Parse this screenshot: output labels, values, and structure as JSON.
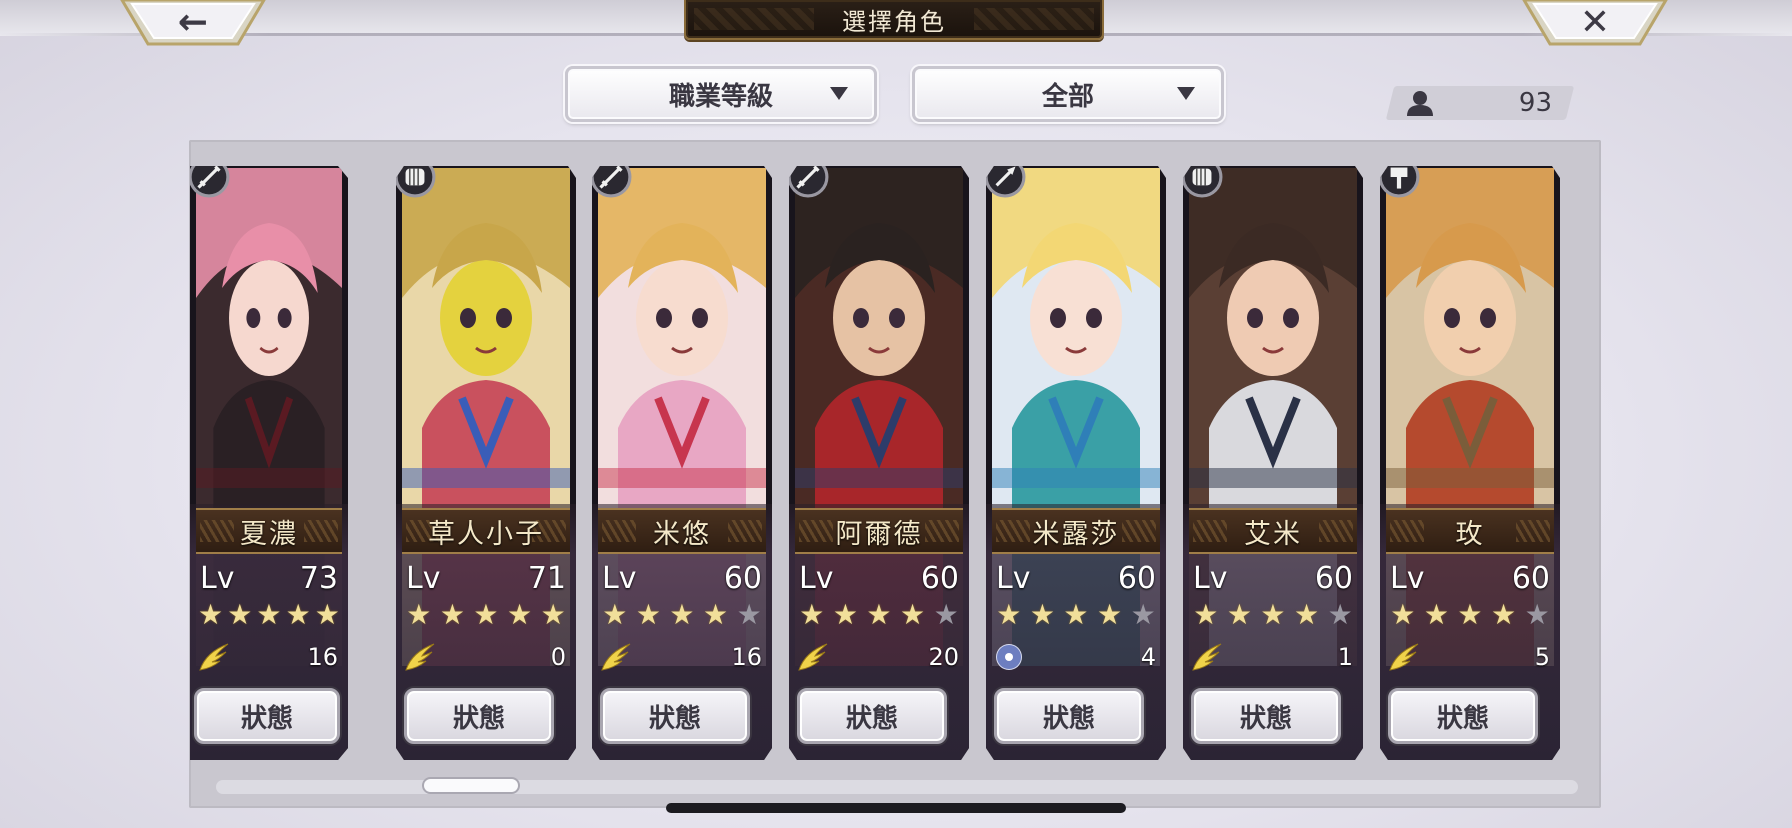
{
  "header": {
    "title": "選擇角色",
    "back_symbol": "←",
    "close_symbol": "✕"
  },
  "filters": {
    "job_sort": "職業等級",
    "category": "全部"
  },
  "roster_count": "93",
  "status_label": "狀態",
  "level_prefix": "Lv",
  "colors": {
    "gold": "#f1df9a",
    "frame_gold": "#a07e48",
    "panel": "#c9c7cf",
    "name_bar": "#3a2616"
  },
  "characters": [
    {
      "name": "夏濃",
      "level": "73",
      "stars": 5,
      "awaken": "16",
      "awaken_icon": "wing-icon",
      "class_icon": "sword-icon"
    },
    {
      "name": "草人小子",
      "level": "71",
      "stars": 5,
      "awaken": "0",
      "awaken_icon": "wing-icon",
      "class_icon": "fist-icon"
    },
    {
      "name": "米悠",
      "level": "60",
      "stars": 4,
      "awaken": "16",
      "awaken_icon": "wing-icon",
      "class_icon": "sword-icon"
    },
    {
      "name": "阿爾德",
      "level": "60",
      "stars": 4,
      "awaken": "20",
      "awaken_icon": "wing-icon",
      "class_icon": "sword-icon"
    },
    {
      "name": "米露莎",
      "level": "60",
      "stars": 4,
      "awaken": "4",
      "awaken_icon": "swirl-icon",
      "class_icon": "spear-icon"
    },
    {
      "name": "艾米",
      "level": "60",
      "stars": 4,
      "awaken": "1",
      "awaken_icon": "wing-icon",
      "class_icon": "fist-icon"
    },
    {
      "name": "玫",
      "level": "60",
      "stars": 4,
      "awaken": "5",
      "awaken_icon": "wing-icon",
      "class_icon": "hammer-icon"
    }
  ]
}
